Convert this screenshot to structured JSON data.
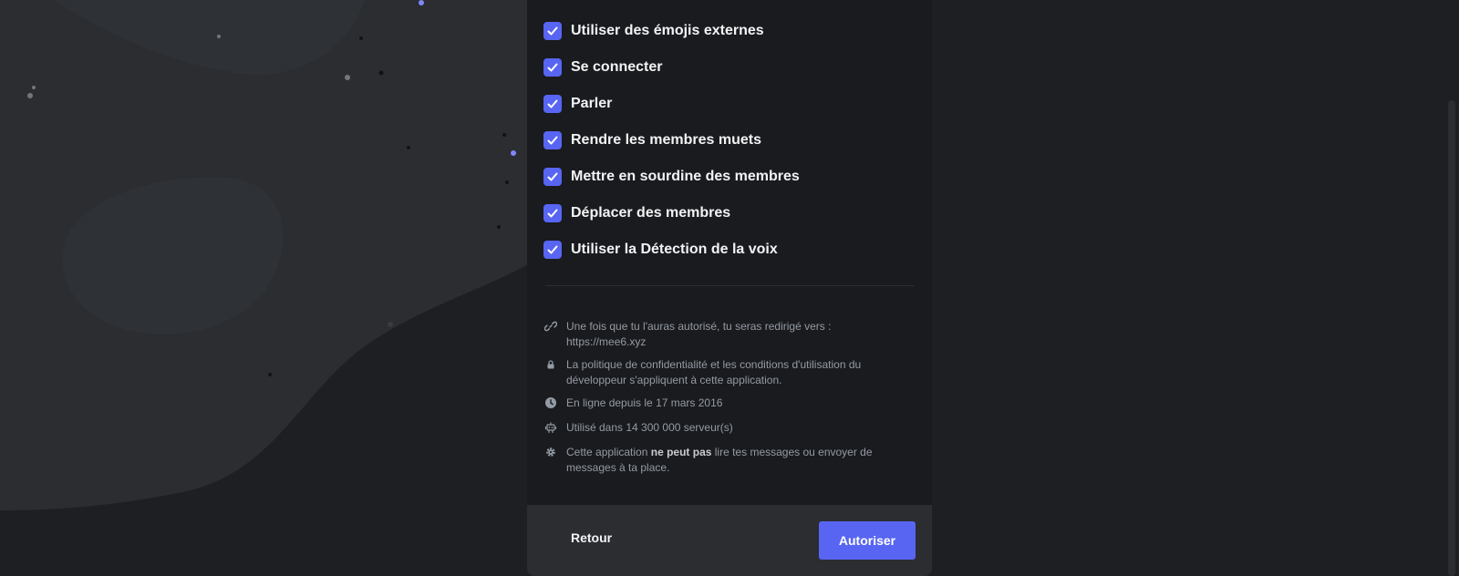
{
  "permissions": [
    {
      "label": "Utiliser des émojis externes",
      "checked": true
    },
    {
      "label": "Se connecter",
      "checked": true
    },
    {
      "label": "Parler",
      "checked": true
    },
    {
      "label": "Rendre les membres muets",
      "checked": true
    },
    {
      "label": "Mettre en sourdine des membres",
      "checked": true
    },
    {
      "label": "Déplacer des membres",
      "checked": true
    },
    {
      "label": "Utiliser la Détection de la voix",
      "checked": true
    }
  ],
  "info": {
    "redirect_line1": "Une fois que tu l'auras autorisé, tu seras redirigé vers :",
    "redirect_url": "https://mee6.xyz",
    "privacy": "La politique de confidentialité et les conditions d'utilisation du développeur s'appliquent à cette application.",
    "online_since": "En ligne depuis le 17 mars 2016",
    "servers": "Utilisé dans 14 300 000 serveur(s)",
    "cannot_part1": "Cette application",
    "cannot_bold": "ne peut pas",
    "cannot_part2": "lire tes messages ou envoyer de messages à ta place."
  },
  "footer": {
    "back_label": "Retour",
    "authorize_label": "Autoriser"
  },
  "icons": {
    "checkbox": "checkmark-icon",
    "redirect": "link-icon",
    "privacy": "lock-icon",
    "online": "clock-icon",
    "servers": "robot-icon",
    "cannot": "gear-icon"
  },
  "colors": {
    "accent": "#5865f2",
    "modal_bg": "#1a1b1e",
    "footer_bg": "#2b2d31",
    "page_bg": "#1e1f22"
  }
}
